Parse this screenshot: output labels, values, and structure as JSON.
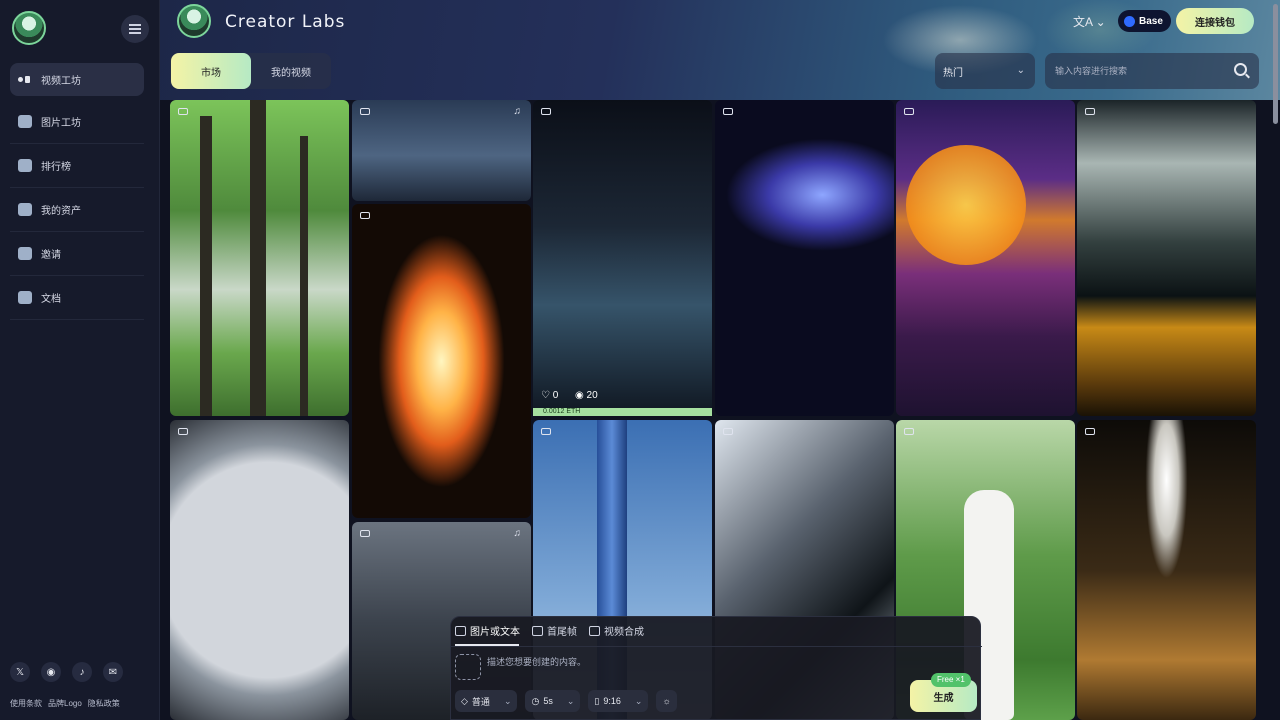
{
  "app": {
    "title": "Creator Labs"
  },
  "sidebar": {
    "items": [
      {
        "label": "视频工坊",
        "icon": "video-studio-icon",
        "active": true
      },
      {
        "label": "图片工坊",
        "icon": "camera-icon"
      },
      {
        "label": "排行榜",
        "icon": "ranking-icon"
      },
      {
        "label": "我的资产",
        "icon": "folder-icon"
      },
      {
        "label": "邀请",
        "icon": "user-invite-icon"
      },
      {
        "label": "文档",
        "icon": "document-icon"
      }
    ],
    "social": [
      {
        "icon": "x-icon",
        "glyph": "𝕏"
      },
      {
        "icon": "discord-icon",
        "glyph": "◉"
      },
      {
        "icon": "tiktok-icon",
        "glyph": "♪"
      },
      {
        "icon": "mail-icon",
        "glyph": "✉"
      }
    ],
    "footer": {
      "terms": "使用条款",
      "brand": "品牌Logo",
      "privacy": "隐私政策"
    }
  },
  "header": {
    "lang_glyph": "文A ⌄",
    "network": "Base",
    "connect": "连接钱包"
  },
  "tabs": {
    "market": "市场",
    "my_videos": "我的视频"
  },
  "filter": {
    "sort": "热门",
    "search_placeholder": "输入内容进行搜索"
  },
  "featured": {
    "likes": "0",
    "views": "20",
    "price": "0.0012 ETH"
  },
  "composer": {
    "tabs": [
      "图片或文本",
      "首尾帧",
      "视频合成"
    ],
    "placeholder": "描述您想要创建的内容。",
    "options": {
      "quality": "普通",
      "duration": "5s",
      "ratio": "9:16"
    },
    "free_badge": "Free ×1",
    "generate": "生成"
  }
}
